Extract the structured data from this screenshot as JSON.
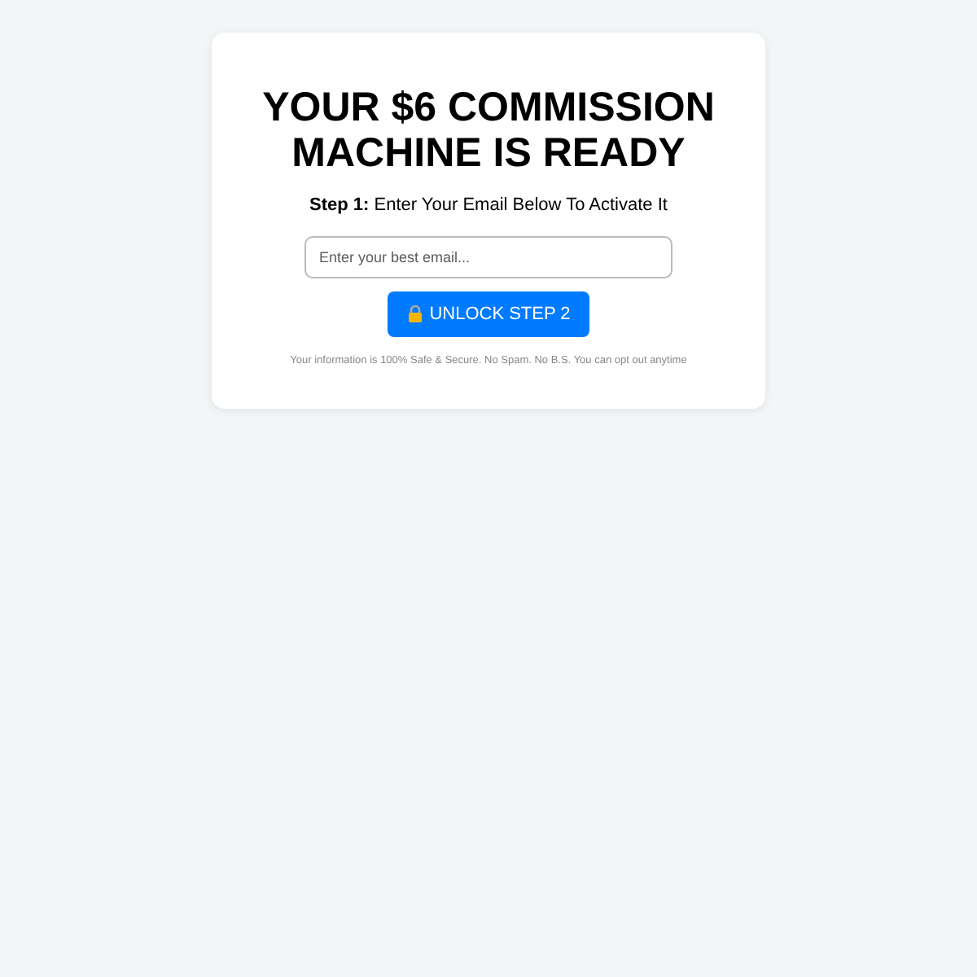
{
  "headline": "YOUR $6 COMMISSION MACHINE IS READY",
  "subheading": "**Step 1:** Enter Your Email Below To Activate It",
  "email_field": {
    "placeholder": "Enter your best email..."
  },
  "button": {
    "label": "UNLOCK STEP 2"
  },
  "disclaimer": "Your information is 100% Safe & Secure. No Spam. No B.S. You can opt out anytime"
}
